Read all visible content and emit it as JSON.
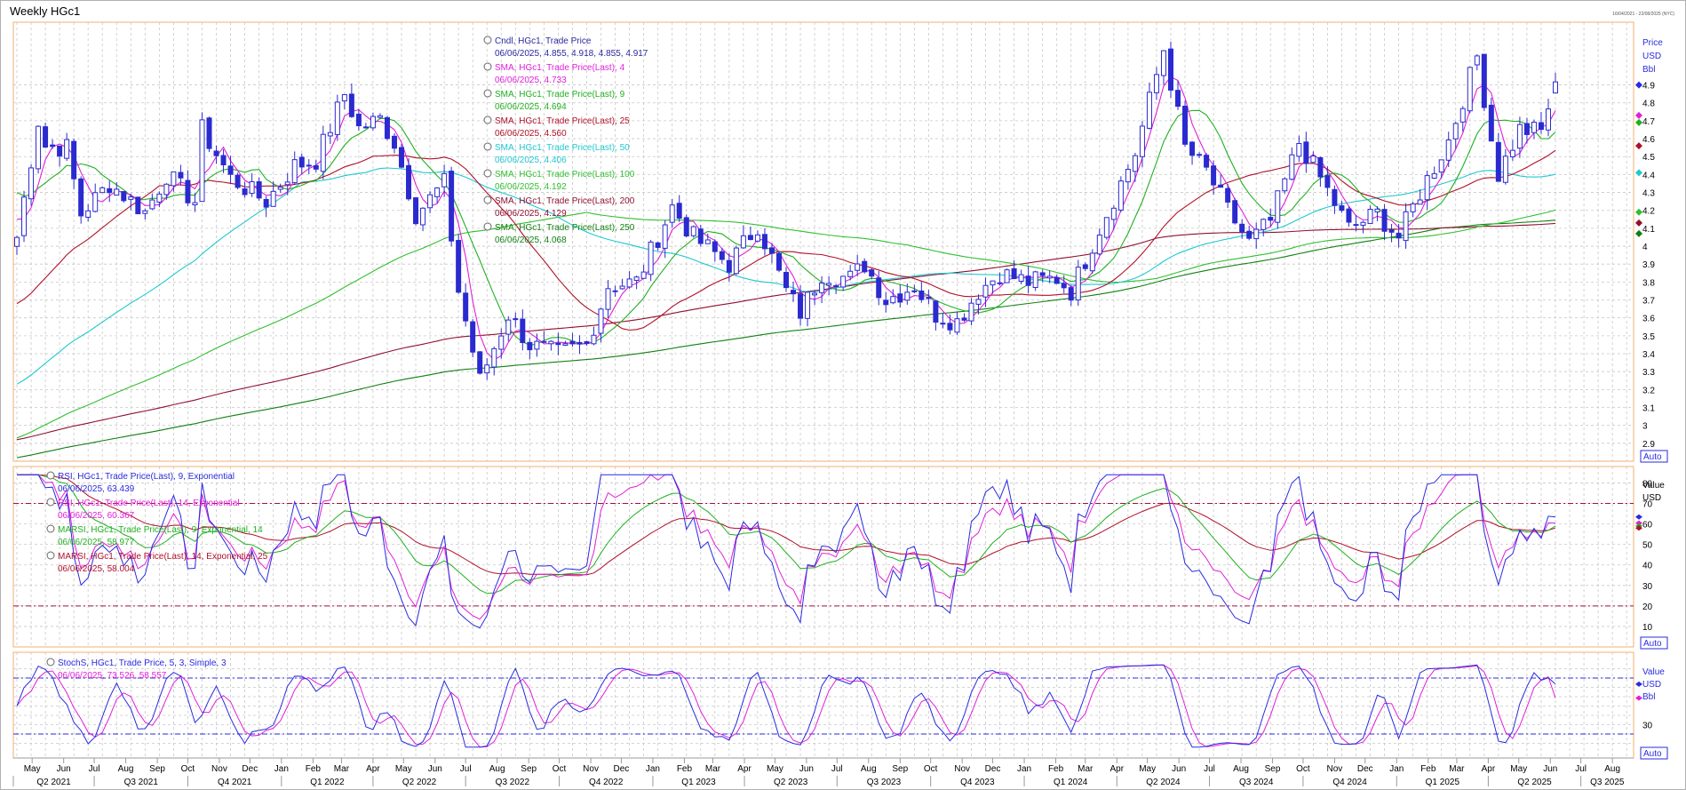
{
  "window": {
    "title": "Weekly HGc1",
    "timestamp": "16/04/2021 - 22/08/2025 (NYC)"
  },
  "price_panel": {
    "axis_labels": [
      "Price",
      "USD",
      "Bbl"
    ],
    "auto": "Auto",
    "legend": [
      {
        "name": "Cndl, HGc1, Trade Price",
        "value": "06/06/2025, 4.855, 4.918, 4.855, 4.917",
        "color": "#2a2aa0"
      },
      {
        "name": "SMA, HGc1, Trade Price(Last), 4",
        "value": "06/06/2025, 4.733",
        "color": "#e020d8"
      },
      {
        "name": "SMA, HGc1, Trade Price(Last), 9",
        "value": "06/06/2025, 4.694",
        "color": "#20b020"
      },
      {
        "name": "SMA, HGc1, Trade Price(Last), 25",
        "value": "06/06/2025, 4.560",
        "color": "#b01028"
      },
      {
        "name": "SMA, HGc1, Trade Price(Last), 50",
        "value": "06/06/2025, 4.406",
        "color": "#20c8d0"
      },
      {
        "name": "SMA, HGc1, Trade Price(Last), 100",
        "value": "06/06/2025, 4.192",
        "color": "#30c030"
      },
      {
        "name": "SMA, HGc1, Trade Price(Last), 200",
        "value": "06/06/2025, 4.129",
        "color": "#901030"
      },
      {
        "name": "SMA, HGc1, Trade Price(Last), 250",
        "value": "06/06/2025, 4.068",
        "color": "#108010"
      }
    ]
  },
  "rsi_panel": {
    "axis_labels": [
      "Value",
      "USD"
    ],
    "auto": "Auto",
    "legend": [
      {
        "name": "RSI, HGc1, Trade Price(Last), 9, Exponential",
        "value": "06/06/2025, 63.439",
        "color": "#2a2ae0"
      },
      {
        "name": "RSI, HGc1, Trade Price(Last), 14, Exponential",
        "value": "06/06/2025, 60.367",
        "color": "#e020d8"
      },
      {
        "name": "MARSI, HGc1, Trade Price(Last), 9, Exponential, 14",
        "value": "06/06/2025, 58.977",
        "color": "#20b020"
      },
      {
        "name": "MARSI, HGc1, Trade Price(Last), 14, Exponential, 25",
        "value": "06/06/2025, 58.004",
        "color": "#b01028"
      }
    ]
  },
  "stoch_panel": {
    "axis_labels": [
      "Value",
      "USD",
      "Bbl"
    ],
    "auto": "Auto",
    "legend": [
      {
        "name": "StochS, HGc1, Trade Price, 5, 3, Simple, 3",
        "value": "06/06/2025, 73.526, 58.557",
        "color": "#2a2ae0"
      }
    ]
  },
  "x_axis": {
    "months": [
      "May",
      "Jun",
      "Jul",
      "Aug",
      "Sep",
      "Oct",
      "Nov",
      "Dec",
      "Jan",
      "Feb",
      "Mar",
      "Apr",
      "May",
      "Jun",
      "Jul",
      "Aug",
      "Sep",
      "Oct",
      "Nov",
      "Dec",
      "Jan",
      "Feb",
      "Mar",
      "Apr",
      "May",
      "Jun",
      "Jul",
      "Aug",
      "Sep",
      "Oct",
      "Nov",
      "Dec",
      "Jan",
      "Feb",
      "Mar",
      "Apr",
      "May",
      "Jun",
      "Jul",
      "Aug",
      "Sep",
      "Oct",
      "Nov",
      "Dec",
      "Jan",
      "Feb",
      "Mar",
      "Apr",
      "May",
      "Jun",
      "Jul",
      "Aug"
    ],
    "quarters": [
      "Q2 2021",
      "Q3 2021",
      "Q4 2021",
      "Q1 2022",
      "Q2 2022",
      "Q3 2022",
      "Q4 2022",
      "Q1 2023",
      "Q2 2023",
      "Q3 2023",
      "Q4 2023",
      "Q1 2024",
      "Q2 2024",
      "Q3 2024",
      "Q4 2024",
      "Q1 2025",
      "Q2 2025",
      "Q3 2025"
    ]
  },
  "chart_data": [
    {
      "type": "line",
      "subtype": "candlestick",
      "title": "Weekly HGc1",
      "ylabel": "Price USD Bbl",
      "ylim": [
        2.8,
        5.25
      ],
      "yticks": [
        2.9,
        3,
        3.1,
        3.2,
        3.3,
        3.4,
        3.5,
        3.6,
        3.7,
        3.8,
        3.9,
        4,
        4.1,
        4.2,
        4.3,
        4.4,
        4.5,
        4.6,
        4.7,
        4.8,
        4.9
      ],
      "x_start": "2021-04-16",
      "x_end": "2025-06-06",
      "close_anchors": [
        [
          "2021-04-16",
          4.05
        ],
        [
          "2021-05-07",
          4.7
        ],
        [
          "2021-05-14",
          4.56
        ],
        [
          "2021-06-04",
          4.55
        ],
        [
          "2021-06-18",
          4.18
        ],
        [
          "2021-07-16",
          4.35
        ],
        [
          "2021-08-20",
          4.19
        ],
        [
          "2021-09-10",
          4.4
        ],
        [
          "2021-10-08",
          4.25
        ],
        [
          "2021-10-15",
          4.65
        ],
        [
          "2021-11-12",
          4.38
        ],
        [
          "2021-12-17",
          4.25
        ],
        [
          "2022-01-14",
          4.45
        ],
        [
          "2022-02-04",
          4.48
        ],
        [
          "2022-03-04",
          4.85
        ],
        [
          "2022-03-18",
          4.66
        ],
        [
          "2022-04-08",
          4.71
        ],
        [
          "2022-04-22",
          4.58
        ],
        [
          "2022-05-13",
          4.18
        ],
        [
          "2022-06-10",
          4.35
        ],
        [
          "2022-06-24",
          3.75
        ],
        [
          "2022-07-15",
          3.25
        ],
        [
          "2022-08-12",
          3.62
        ],
        [
          "2022-09-02",
          3.45
        ],
        [
          "2022-09-30",
          3.4
        ],
        [
          "2022-10-28",
          3.45
        ],
        [
          "2022-11-18",
          3.78
        ],
        [
          "2022-12-16",
          3.8
        ],
        [
          "2023-01-20",
          4.22
        ],
        [
          "2023-02-10",
          4.05
        ],
        [
          "2023-03-17",
          3.9
        ],
        [
          "2023-04-14",
          4.12
        ],
        [
          "2023-05-12",
          3.75
        ],
        [
          "2023-05-26",
          3.63
        ],
        [
          "2023-06-16",
          3.85
        ],
        [
          "2023-07-14",
          3.82
        ],
        [
          "2023-07-28",
          3.9
        ],
        [
          "2023-08-18",
          3.7
        ],
        [
          "2023-09-15",
          3.78
        ],
        [
          "2023-10-06",
          3.62
        ],
        [
          "2023-10-27",
          3.58
        ],
        [
          "2023-11-17",
          3.75
        ],
        [
          "2023-12-08",
          3.85
        ],
        [
          "2024-01-05",
          3.8
        ],
        [
          "2024-02-02",
          3.82
        ],
        [
          "2024-02-16",
          3.75
        ],
        [
          "2024-03-15",
          4.1
        ],
        [
          "2024-04-19",
          4.52
        ],
        [
          "2024-05-17",
          5.1
        ],
        [
          "2024-06-07",
          4.55
        ],
        [
          "2024-06-28",
          4.42
        ],
        [
          "2024-07-19",
          4.2
        ],
        [
          "2024-08-09",
          4.02
        ],
        [
          "2024-08-30",
          4.14
        ],
        [
          "2024-09-27",
          4.58
        ],
        [
          "2024-10-18",
          4.38
        ],
        [
          "2024-11-15",
          4.1
        ],
        [
          "2024-12-13",
          4.18
        ],
        [
          "2025-01-03",
          4.05
        ],
        [
          "2025-01-24",
          4.3
        ],
        [
          "2025-02-21",
          4.59
        ],
        [
          "2025-03-21",
          5.06
        ],
        [
          "2025-04-04",
          4.6
        ],
        [
          "2025-04-11",
          4.4
        ],
        [
          "2025-05-02",
          4.65
        ],
        [
          "2025-05-23",
          4.64
        ],
        [
          "2025-06-06",
          4.917
        ]
      ],
      "last_candle": {
        "date": "2025-06-06",
        "open": 4.855,
        "high": 4.918,
        "low": 4.855,
        "close": 4.917
      },
      "series": [
        {
          "name": "SMA, HGc1, Trade Price(Last), 4",
          "last": 4.733
        },
        {
          "name": "SMA, HGc1, Trade Price(Last), 9",
          "last": 4.694
        },
        {
          "name": "SMA, HGc1, Trade Price(Last), 25",
          "last": 4.56
        },
        {
          "name": "SMA, HGc1, Trade Price(Last), 50",
          "last": 4.406
        },
        {
          "name": "SMA, HGc1, Trade Price(Last), 100",
          "last": 4.192
        },
        {
          "name": "SMA, HGc1, Trade Price(Last), 200",
          "last": 4.129
        },
        {
          "name": "SMA, HGc1, Trade Price(Last), 250",
          "last": 4.068
        }
      ]
    },
    {
      "type": "line",
      "title": "RSI",
      "ylim": [
        0,
        88
      ],
      "yticks": [
        10,
        20,
        30,
        40,
        50,
        60,
        70,
        80
      ],
      "reference_lines": [
        20,
        70
      ],
      "series": [
        {
          "name": "RSI, HGc1, Trade Price(Last), 9, Exponential",
          "last": 63.439
        },
        {
          "name": "RSI, HGc1, Trade Price(Last), 14, Exponential",
          "last": 60.367
        },
        {
          "name": "MARSI, HGc1, Trade Price(Last), 9, Exponential, 14",
          "last": 58.977
        },
        {
          "name": "MARSI, HGc1, Trade Price(Last), 14, Exponential, 25",
          "last": 58.004
        }
      ]
    },
    {
      "type": "line",
      "title": "StochS",
      "ylim": [
        0,
        100
      ],
      "yticks": [
        30
      ],
      "reference_lines": [
        20,
        80
      ],
      "series": [
        {
          "name": "StochS %K",
          "last": 73.526
        },
        {
          "name": "StochS %D",
          "last": 58.557
        }
      ]
    }
  ]
}
